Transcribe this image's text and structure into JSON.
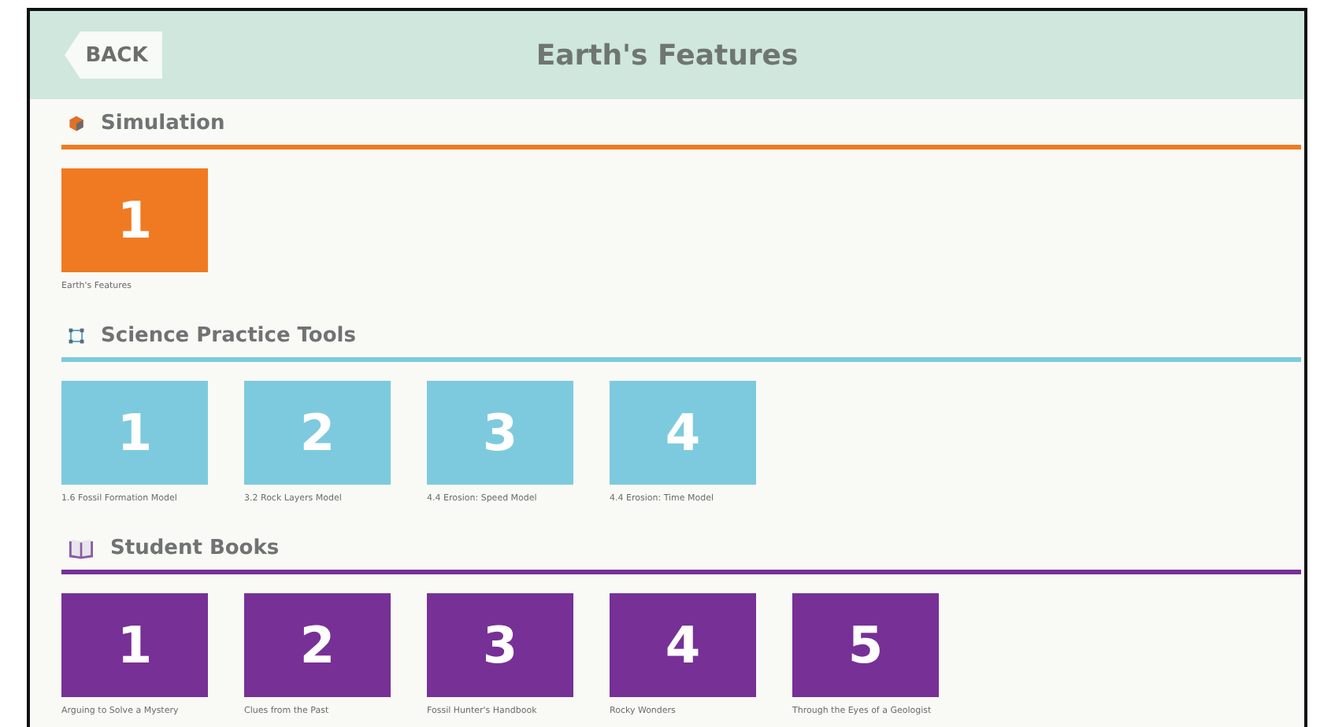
{
  "header": {
    "back_button": "BACK",
    "title": "Earth's Features"
  },
  "sections": [
    {
      "kind": "simulation",
      "title": "Simulation",
      "color": "#f07a22",
      "tiles": [
        {
          "number": "1",
          "caption": "Earth's Features"
        }
      ]
    },
    {
      "kind": "tools",
      "title": "Science Practice Tools",
      "color": "#7dcade",
      "tiles": [
        {
          "number": "1",
          "caption": "1.6 Fossil Formation Model"
        },
        {
          "number": "2",
          "caption": "3.2 Rock Layers Model"
        },
        {
          "number": "3",
          "caption": "4.4 Erosion: Speed Model"
        },
        {
          "number": "4",
          "caption": "4.4 Erosion: Time Model"
        }
      ]
    },
    {
      "kind": "books",
      "title": "Student Books",
      "color": "#773096",
      "tiles": [
        {
          "number": "1",
          "caption": "Arguing to Solve a Mystery"
        },
        {
          "number": "2",
          "caption": "Clues from the Past"
        },
        {
          "number": "3",
          "caption": "Fossil Hunter's Handbook"
        },
        {
          "number": "4",
          "caption": "Rocky Wonders"
        },
        {
          "number": "5",
          "caption": "Through the Eyes of a Geologist"
        }
      ]
    }
  ]
}
